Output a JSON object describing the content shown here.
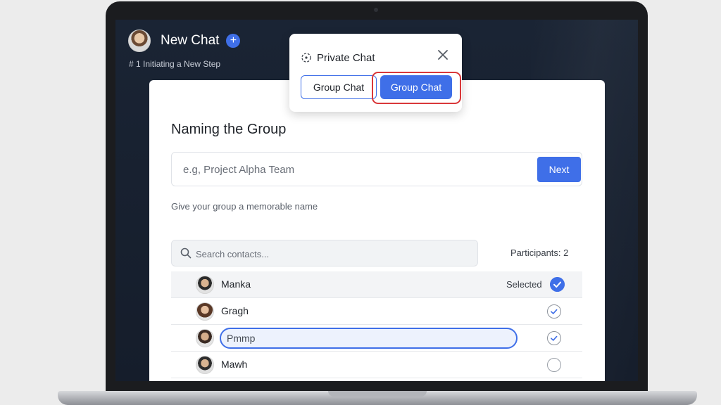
{
  "header": {
    "title": "New Chat",
    "add_label": "+",
    "step": "# 1 Initiating a New Step"
  },
  "popup": {
    "title": "Private Chat",
    "option_outline": "Group Chat",
    "option_selected": "Group Chat"
  },
  "card": {
    "title": "Naming the Group",
    "name_placeholder": "e.g, Project Alpha Team",
    "next_label": "Next",
    "helper": "Give your group a memorable name",
    "search_placeholder": "Search contacts...",
    "participants": "Participants: 2"
  },
  "contacts": [
    {
      "name": "Manka",
      "status": "Selected"
    },
    {
      "name": "Gragh"
    },
    {
      "name": "Pmmp"
    },
    {
      "name": "Mawh"
    }
  ],
  "colors": {
    "accent": "#3f6fe8",
    "highlight": "#d9383a"
  }
}
